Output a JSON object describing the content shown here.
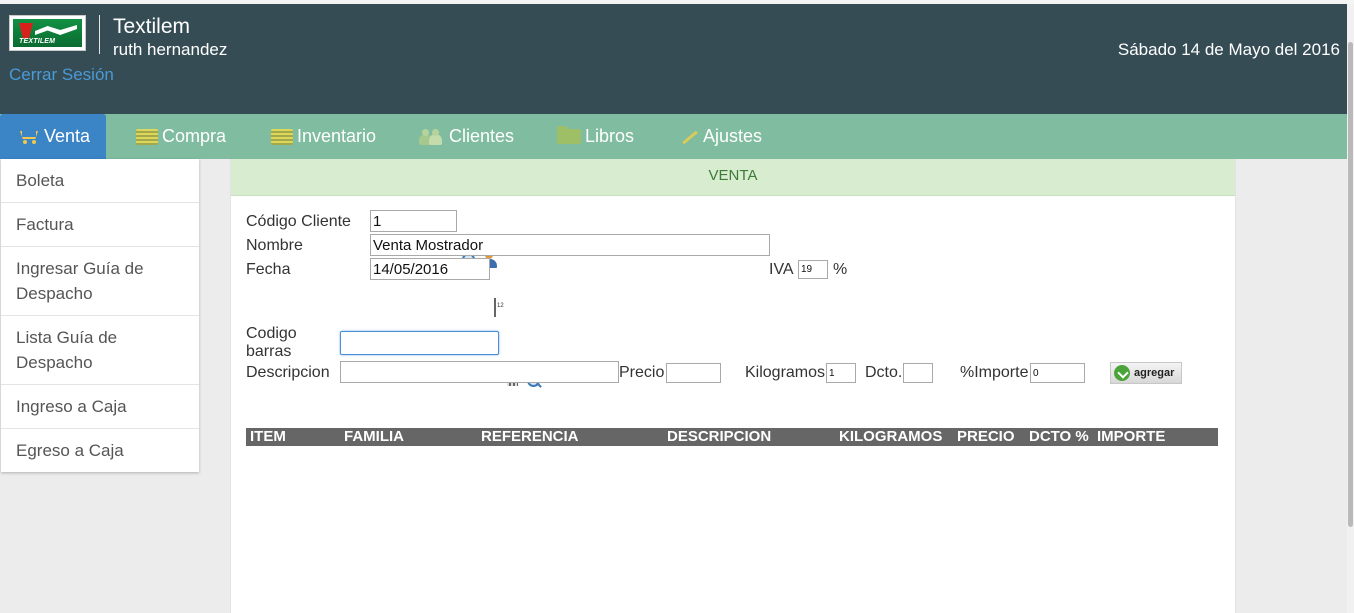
{
  "header": {
    "logo_text": "TEXTILEM",
    "app_title": "Textilem",
    "user_name": "ruth hernandez",
    "logout_label": "Cerrar Sesión",
    "date_text": "Sábado 14 de Mayo del 2016",
    "background_color": "#364c55"
  },
  "nav": {
    "items": [
      {
        "label": "Venta",
        "icon": "cart-icon",
        "active": true
      },
      {
        "label": "Compra",
        "icon": "list-icon"
      },
      {
        "label": "Inventario",
        "icon": "list-icon"
      },
      {
        "label": "Clientes",
        "icon": "users-icon"
      },
      {
        "label": "Libros",
        "icon": "folder-icon"
      },
      {
        "label": "Ajustes",
        "icon": "wrench-icon"
      }
    ],
    "background_color": "#80bca0",
    "active_color": "#3b85c6"
  },
  "sidebar": {
    "items": [
      {
        "label": "Boleta"
      },
      {
        "label": "Factura"
      },
      {
        "label": "Ingresar Guía de Despacho"
      },
      {
        "label": "Lista Guía de Despacho"
      },
      {
        "label": "Ingreso a Caja"
      },
      {
        "label": "Egreso a Caja"
      }
    ]
  },
  "panel": {
    "title": "VENTA",
    "form": {
      "codigo_cliente_label": "Código Cliente",
      "codigo_cliente_value": "1",
      "nombre_label": "Nombre",
      "nombre_value": "Venta Mostrador",
      "fecha_label": "Fecha",
      "fecha_value": "14/05/2016",
      "iva_label": "IVA",
      "iva_value": "19",
      "iva_unit": "%",
      "codigo_barras_label_1": "Codigo",
      "codigo_barras_label_2": "barras",
      "codigo_barras_value": "",
      "descripcion_label": "Descripcion",
      "descripcion_value": "",
      "precio_label": "Precio",
      "precio_value": "",
      "kilogramos_label": "Kilogramos",
      "kilogramos_value": "1",
      "dcto_label": "Dcto.",
      "dcto_value": "",
      "importe_label": "%Importe",
      "importe_value": "0",
      "add_button_label": "agregar"
    },
    "table": {
      "columns": [
        "ITEM",
        "FAMILIA",
        "REFERENCIA",
        "DESCRIPCION",
        "KILOGRAMOS",
        "PRECIO",
        "DCTO %",
        "IMPORTE"
      ]
    }
  }
}
